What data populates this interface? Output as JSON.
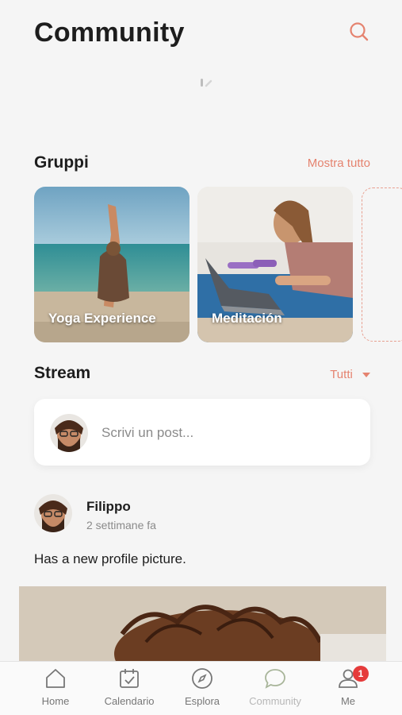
{
  "header": {
    "title": "Community",
    "search_icon": "search-icon"
  },
  "colors": {
    "accent": "#e5836f",
    "badge": "#e53b3b"
  },
  "groups": {
    "title": "Gruppi",
    "see_all": "Mostra tutto",
    "items": [
      {
        "label": "Yoga Experience"
      },
      {
        "label": "Meditación"
      }
    ]
  },
  "stream": {
    "title": "Stream",
    "filter": "Tutti",
    "composer_placeholder": "Scrivi un post..."
  },
  "post": {
    "author": "Filippo",
    "time": "2 settimane fa",
    "text": "Has a new profile picture."
  },
  "tabbar": {
    "items": [
      {
        "label": "Home",
        "icon": "home-icon"
      },
      {
        "label": "Calendario",
        "icon": "calendar-icon"
      },
      {
        "label": "Esplora",
        "icon": "compass-icon"
      },
      {
        "label": "Community",
        "icon": "chat-icon"
      },
      {
        "label": "Me",
        "icon": "profile-icon",
        "badge": "1"
      }
    ]
  }
}
